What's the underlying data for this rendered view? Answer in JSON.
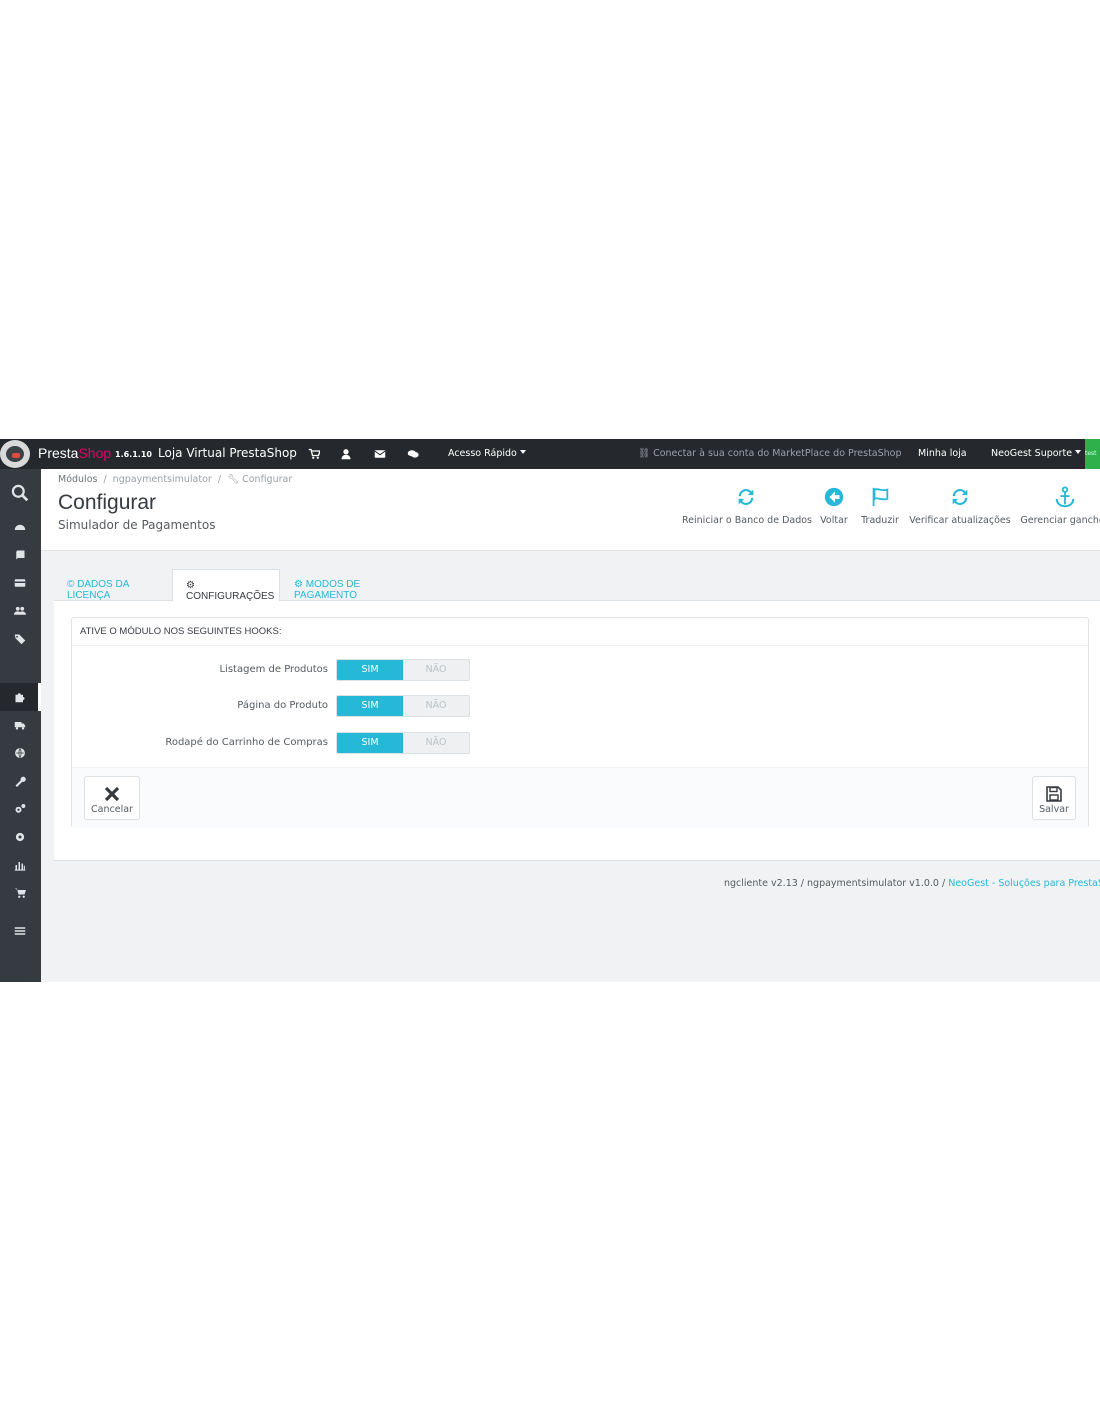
{
  "topbar": {
    "brand_a": "Presta",
    "brand_b": "Shop",
    "version": "1.6.1.10",
    "shop_name": "Loja Virtual PrestaShop",
    "icons": [
      "cart-icon",
      "user-icon",
      "envelope-icon",
      "comments-icon"
    ],
    "quick_access": "Acesso Rápido",
    "marketplace": "Conectar à sua conta do MarketPlace do PrestaShop",
    "my_store": "Minha loja",
    "user": "NeoGest Suporte",
    "badge": "test"
  },
  "sidebar": {
    "items": [
      "search-icon",
      "dashboard-icon",
      "book-icon",
      "credit-card-icon",
      "users-icon",
      "tags-icon",
      "puzzle-icon",
      "truck-icon",
      "globe-icon",
      "wrench-icon",
      "cogs-icon",
      "gear-icon",
      "bar-chart-icon",
      "shopping-cart-icon",
      "list-icon"
    ]
  },
  "breadcrumb": {
    "modules": "Módulos",
    "sep": "/",
    "module": "ngpaymentsimulator",
    "current": "Configurar"
  },
  "header": {
    "title": "Configurar",
    "subtitle": "Simulador de Pagamentos"
  },
  "toolbar": {
    "reset_db": "Reiniciar o Banco de Dados",
    "back": "Voltar",
    "translate": "Traduzir",
    "check_updates": "Verificar atualizações",
    "manage_hooks": "Gerenciar ganchos"
  },
  "tabs": {
    "license": "Dados da licença",
    "settings": "Configurações",
    "payment_modes": "Modos de pagamento"
  },
  "panel": {
    "heading": "Ative o módulo nos seguintes hooks:",
    "rows": [
      {
        "label": "Listagem de Produtos",
        "yes": "SIM",
        "no": "NÃO"
      },
      {
        "label": "Página do Produto",
        "yes": "SIM",
        "no": "NÃO"
      },
      {
        "label": "Rodapé do Carrinho de Compras",
        "yes": "SIM",
        "no": "NÃO"
      }
    ],
    "cancel": "Cancelar",
    "save": "Salvar"
  },
  "footer": {
    "text": "ngcliente v2.13 / ngpaymentsimulator v1.0.0 / ",
    "link": "NeoGest - Soluções para PrestaShop"
  },
  "colors": {
    "accent": "#25b9d7",
    "topbar": "#25292d",
    "sidebar": "#363a41",
    "badge": "#2eb14b",
    "brand": "#df0067"
  }
}
